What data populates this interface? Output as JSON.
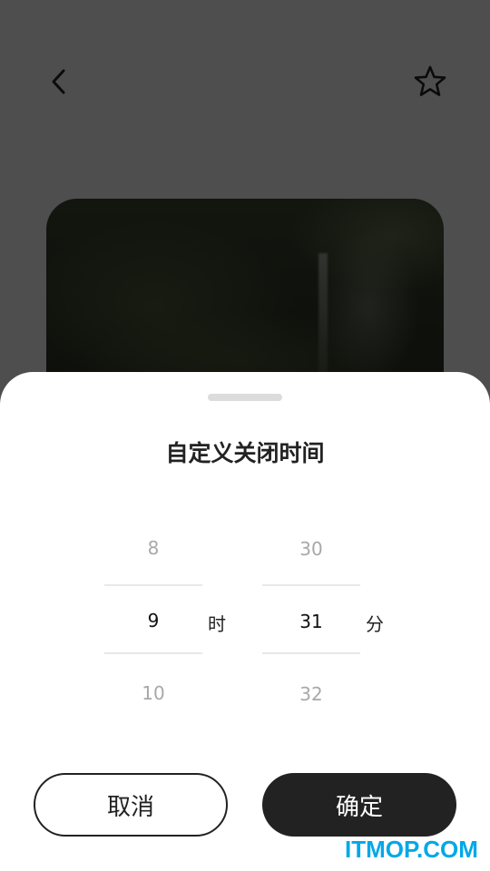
{
  "header": {
    "back_icon": "chevron-left-icon",
    "favorite_icon": "star-outline-icon"
  },
  "sheet": {
    "title": "自定义关闭时间",
    "hours": {
      "above": "8",
      "selected": "9",
      "below": "10",
      "unit": "时"
    },
    "minutes": {
      "above": "30",
      "selected": "31",
      "below": "32",
      "unit": "分"
    },
    "cancel_label": "取消",
    "confirm_label": "确定"
  },
  "watermark": "ITMOP.COM",
  "colors": {
    "primary": "#222222",
    "muted": "#a8a8a8",
    "watermark": "#00a8e8"
  }
}
